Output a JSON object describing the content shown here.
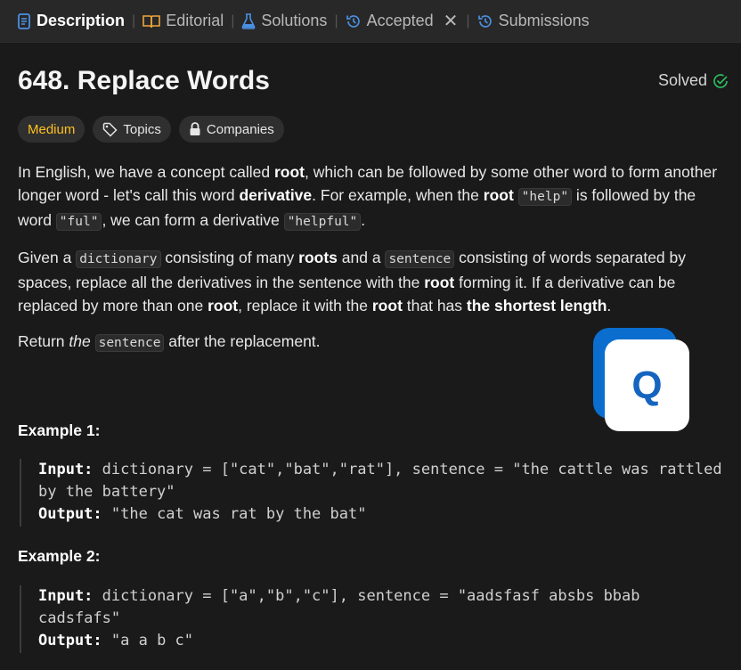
{
  "tabs": [
    {
      "label": "Description",
      "icon": "document-icon"
    },
    {
      "label": "Editorial",
      "icon": "book-icon"
    },
    {
      "label": "Solutions",
      "icon": "flask-icon"
    },
    {
      "label": "Accepted",
      "icon": "history-icon"
    },
    {
      "label": "Submissions",
      "icon": "history-icon"
    }
  ],
  "problem": {
    "title": "648. Replace Words",
    "status": "Solved",
    "difficulty": "Medium",
    "topics_label": "Topics",
    "companies_label": "Companies"
  },
  "description": {
    "p1": {
      "a": "In English, we have a concept called ",
      "b": "root",
      "c": ", which can be followed by some other word to form another longer word - let's call this word ",
      "d": "derivative",
      "e": ". For example, when the ",
      "f": "root",
      "g": " ",
      "h": "\"help\"",
      "i": " is followed by the word ",
      "j": "\"ful\"",
      "k": ", we can form a derivative ",
      "l": "\"helpful\"",
      "m": "."
    },
    "p2": {
      "a": "Given a ",
      "b": "dictionary",
      "c": " consisting of many ",
      "d": "roots",
      "e": " and a ",
      "f": "sentence",
      "g": " consisting of words separated by spaces, replace all the derivatives in the sentence with the ",
      "h": "root",
      "i": " forming it. If a derivative can be replaced by more than one ",
      "j": "root",
      "k": ", replace it with the ",
      "l": "root",
      "m": " that has ",
      "n": "the shortest length",
      "o": "."
    },
    "p3": {
      "a": "Return ",
      "b": "the",
      "c": " ",
      "d": "sentence",
      "e": " after the replacement."
    }
  },
  "examples": [
    {
      "label": "Example 1:",
      "input_key": "Input:",
      "input_value": " dictionary = [\"cat\",\"bat\",\"rat\"], sentence = \"the cattle was rattled by the battery\"",
      "output_key": "Output:",
      "output_value": " \"the cat was rat by the bat\""
    },
    {
      "label": "Example 2:",
      "input_key": "Input:",
      "input_value": " dictionary = [\"a\",\"b\",\"c\"], sentence = \"aadsfasf absbs bbab cadsfafs\"",
      "output_key": "Output:",
      "output_value": " \"a a b c\""
    }
  ],
  "overlay_logo": {
    "letter": "Q"
  },
  "colors": {
    "background": "#1a1a1a",
    "tabbar": "#282828",
    "medium": "#ffc01e",
    "solved_check": "#2cbb5d",
    "accent_blue": "#0b6ecf"
  }
}
